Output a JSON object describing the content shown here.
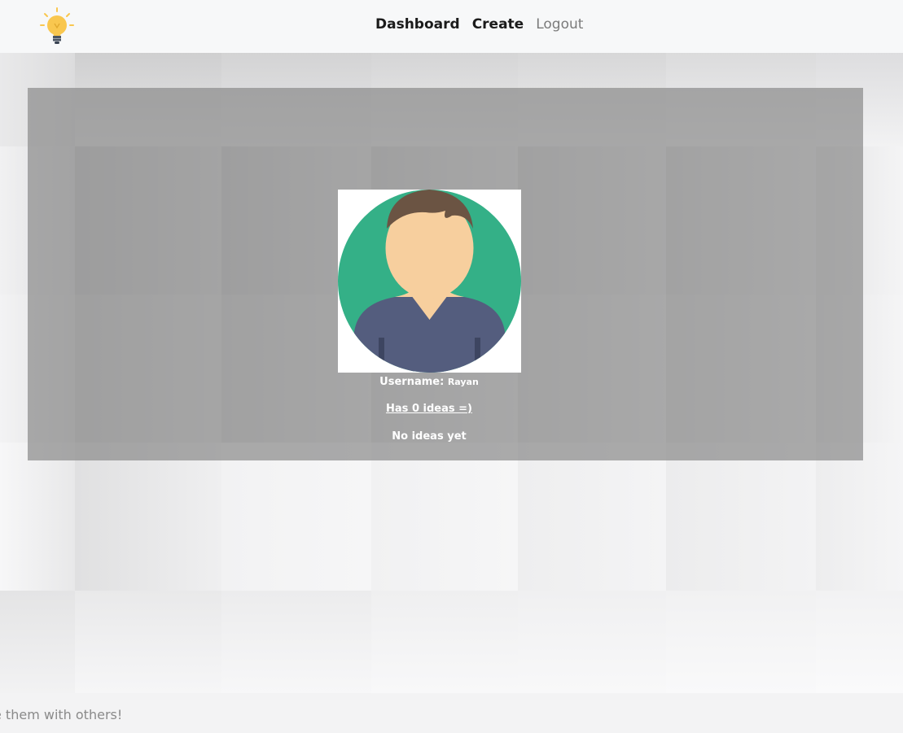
{
  "nav": {
    "links": [
      "Dashboard",
      "Create",
      "Logout"
    ]
  },
  "profile": {
    "username_label": "Username:",
    "username_value": "Rayan",
    "ideas_count_text": "Has 0 ideas =)",
    "empty_text": "No ideas yet"
  },
  "footer": {
    "text": "e them with others!"
  },
  "colors": {
    "avatar_bg": "#34b087",
    "avatar_skin": "#f7cf9e",
    "avatar_hair": "#6b5443",
    "avatar_shirt": "#545d7e",
    "logo_bulb": "#f9c74f",
    "logo_base": "#4b5563"
  }
}
